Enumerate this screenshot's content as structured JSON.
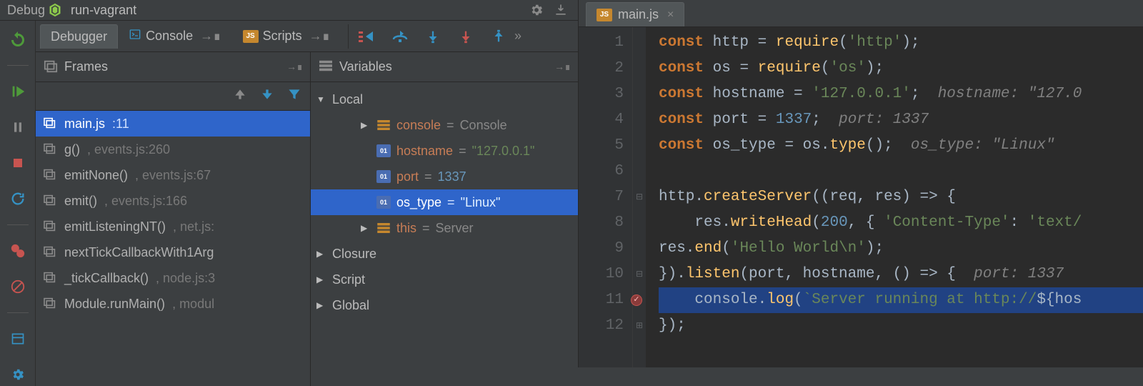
{
  "header": {
    "title": "Debug",
    "run_config": "run-vagrant"
  },
  "tabs": {
    "debugger": "Debugger",
    "console": "Console",
    "scripts": "Scripts"
  },
  "panes": {
    "frames_title": "Frames",
    "variables_title": "Variables"
  },
  "frames": [
    {
      "func": "main.js",
      "loc": ":11",
      "active": true
    },
    {
      "func": "g()",
      "loc": ", events.js:260"
    },
    {
      "func": "emitNone()",
      "loc": ", events.js:67"
    },
    {
      "func": "emit()",
      "loc": ", events.js:166"
    },
    {
      "func": "emitListeningNT()",
      "loc": ", net.js:"
    },
    {
      "func": "nextTickCallbackWith1Arg",
      "loc": ""
    },
    {
      "func": "_tickCallback()",
      "loc": ", node.js:3"
    },
    {
      "func": "Module.runMain()",
      "loc": ", modul"
    }
  ],
  "variables": {
    "scopes": [
      {
        "name": "Local",
        "expanded": true,
        "children": [
          {
            "name": "console",
            "display": "Console",
            "kind": "obj",
            "expandable": true
          },
          {
            "name": "hostname",
            "display": "\"127.0.0.1\"",
            "kind": "str"
          },
          {
            "name": "port",
            "display": "1337",
            "kind": "num"
          },
          {
            "name": "os_type",
            "display": "\"Linux\"",
            "kind": "str",
            "selected": true
          },
          {
            "name": "this",
            "display": "Server",
            "kind": "obj",
            "expandable": true
          }
        ]
      },
      {
        "name": "Closure",
        "expanded": false
      },
      {
        "name": "Script",
        "expanded": false
      },
      {
        "name": "Global",
        "expanded": false
      }
    ]
  },
  "editor": {
    "tab_filename": "main.js",
    "breakpoint_line": 11,
    "lines": [
      {
        "n": 1,
        "tokens": [
          [
            "kw",
            "const "
          ],
          [
            "id",
            "http "
          ],
          [
            "op",
            "= "
          ],
          [
            "fn",
            "require"
          ],
          [
            "op",
            "("
          ],
          [
            "str",
            "'http'"
          ],
          [
            "op",
            ");"
          ]
        ]
      },
      {
        "n": 2,
        "tokens": [
          [
            "kw",
            "const "
          ],
          [
            "id",
            "os "
          ],
          [
            "op",
            "= "
          ],
          [
            "fn",
            "require"
          ],
          [
            "op",
            "("
          ],
          [
            "str",
            "'os'"
          ],
          [
            "op",
            ");"
          ]
        ]
      },
      {
        "n": 3,
        "tokens": [
          [
            "kw",
            "const "
          ],
          [
            "id",
            "hostname "
          ],
          [
            "op",
            "= "
          ],
          [
            "str",
            "'127.0.0.1'"
          ],
          [
            "op",
            ";  "
          ],
          [
            "cm",
            "hostname: \"127.0"
          ]
        ]
      },
      {
        "n": 4,
        "tokens": [
          [
            "kw",
            "const "
          ],
          [
            "id",
            "port "
          ],
          [
            "op",
            "= "
          ],
          [
            "num",
            "1337"
          ],
          [
            "op",
            ";  "
          ],
          [
            "cm",
            "port: 1337"
          ]
        ]
      },
      {
        "n": 5,
        "tokens": [
          [
            "kw",
            "const "
          ],
          [
            "id",
            "os_type "
          ],
          [
            "op",
            "= os."
          ],
          [
            "fn",
            "type"
          ],
          [
            "op",
            "();  "
          ],
          [
            "cm",
            "os_type: \"Linux\""
          ]
        ]
      },
      {
        "n": 6,
        "tokens": [
          [
            "op",
            ""
          ]
        ]
      },
      {
        "n": 7,
        "tokens": [
          [
            "id",
            "http."
          ],
          [
            "fn",
            "createServer"
          ],
          [
            "op",
            "((req, res) "
          ],
          [
            "op",
            "=> {"
          ]
        ],
        "fold": "open"
      },
      {
        "n": 8,
        "tokens": [
          [
            "op",
            "    res."
          ],
          [
            "fn",
            "writeHead"
          ],
          [
            "op",
            "("
          ],
          [
            "num",
            "200"
          ],
          [
            "op",
            ", { "
          ],
          [
            "str",
            "'Content-Type'"
          ],
          [
            "op",
            ": "
          ],
          [
            "str",
            "'text/"
          ]
        ]
      },
      {
        "n": 9,
        "tokens": [
          [
            "op",
            "res."
          ],
          [
            "fn",
            "end"
          ],
          [
            "op",
            "("
          ],
          [
            "str",
            "'Hello World\\n'"
          ],
          [
            "op",
            ");"
          ]
        ]
      },
      {
        "n": 10,
        "tokens": [
          [
            "op",
            "})."
          ],
          [
            "fn",
            "listen"
          ],
          [
            "op",
            "(port, hostname, () "
          ],
          [
            "op",
            "=> {  "
          ],
          [
            "cm",
            "port: 1337"
          ]
        ],
        "fold": "open"
      },
      {
        "n": 11,
        "tokens": [
          [
            "op",
            "    console."
          ],
          [
            "fn",
            "log"
          ],
          [
            "op",
            "("
          ],
          [
            "tpl",
            "`Server running at http://"
          ],
          [
            "op",
            "${"
          ],
          [
            "id",
            "hos"
          ]
        ],
        "current": true,
        "bp": true
      },
      {
        "n": 12,
        "tokens": [
          [
            "op",
            "});"
          ]
        ],
        "fold": "close"
      }
    ]
  }
}
